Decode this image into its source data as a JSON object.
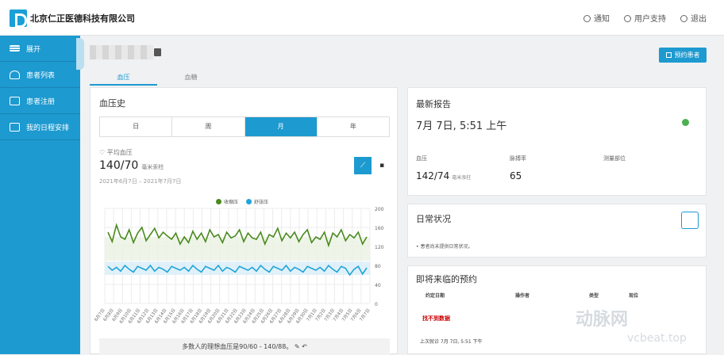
{
  "header": {
    "company": "北京仁正医德科技有限公司",
    "nav": [
      "通知",
      "用户支持",
      "退出"
    ]
  },
  "sidebar": {
    "items": [
      {
        "label": "展开",
        "icon": "menu-icon"
      },
      {
        "label": "患者列表",
        "icon": "user-icon"
      },
      {
        "label": "患者注册",
        "icon": "register-icon"
      },
      {
        "label": "我的日程安排",
        "icon": "calendar-icon"
      }
    ]
  },
  "patient": {
    "appointment_button": "预约患者"
  },
  "tabs": [
    "血压",
    "血糖"
  ],
  "bp": {
    "title": "血压史",
    "periods": [
      "日",
      "周",
      "月",
      "年"
    ],
    "active_period": 2,
    "avg_label": "平均血压",
    "avg_value": "140/70",
    "avg_unit": "毫米汞柱",
    "date_range": "2021年6月7日 – 2021年7月7日",
    "footer_note": "多数人的理想血压是90/60 - 140/88。"
  },
  "chart_data": {
    "type": "line",
    "legend": [
      "收缩压",
      "舒张压"
    ],
    "colors": {
      "systolic": "#4a8a1e",
      "diastolic": "#1ea4d8"
    },
    "ylim": [
      0,
      200
    ],
    "yticks": [
      0,
      40,
      80,
      120,
      160,
      200
    ],
    "categories": [
      "6月7日",
      "6月8日",
      "6月9日",
      "6月10日",
      "6月11日",
      "6月12日",
      "6月13日",
      "6月14日",
      "6月15日",
      "6月16日",
      "6月17日",
      "6月18日",
      "6月19日",
      "6月20日",
      "6月21日",
      "6月22日",
      "6月23日",
      "6月24日",
      "6月25日",
      "6月26日",
      "6月27日",
      "6月28日",
      "6月29日",
      "6月30日",
      "7月1日",
      "7月2日",
      "7月3日",
      "7月4日",
      "7月5日",
      "7月6日",
      "7月7日"
    ],
    "series": [
      {
        "name": "收缩压",
        "values": [
          150,
          130,
          165,
          140,
          135,
          155,
          128,
          148,
          160,
          132,
          145,
          158,
          138,
          150,
          142,
          135,
          148,
          125,
          140,
          128,
          152,
          135,
          148,
          130,
          155,
          140,
          145,
          128,
          150,
          138,
          142,
          155,
          130,
          148,
          138,
          135,
          150,
          125,
          145,
          140,
          158,
          132,
          148,
          138,
          150,
          130,
          145,
          155,
          128,
          140,
          135,
          150,
          122,
          148,
          140,
          155,
          132,
          145,
          138,
          150,
          125,
          140
        ]
      },
      {
        "name": "舒张压",
        "values": [
          78,
          70,
          76,
          68,
          80,
          72,
          66,
          78,
          74,
          70,
          80,
          68,
          76,
          72,
          66,
          78,
          74,
          70,
          76,
          68,
          80,
          72,
          66,
          78,
          74,
          70,
          80,
          68,
          76,
          72,
          66,
          78,
          74,
          70,
          76,
          68,
          80,
          72,
          66,
          78,
          74,
          70,
          80,
          68,
          76,
          72,
          66,
          78,
          74,
          70,
          76,
          68,
          80,
          72,
          66,
          78,
          74,
          60,
          72,
          78,
          62,
          75
        ]
      }
    ],
    "normal_bands": [
      [
        90,
        140
      ],
      [
        60,
        88
      ]
    ]
  },
  "report": {
    "title": "最新报告",
    "date": "7月 7日, 5:51 上午",
    "metrics": [
      {
        "label": "血压",
        "value": "142/74",
        "unit": "毫米汞柱"
      },
      {
        "label": "脉搏率",
        "value": "65",
        "unit": ""
      },
      {
        "label": "测量部位",
        "value": "",
        "unit": ""
      }
    ]
  },
  "daily": {
    "title": "日常状况",
    "item": "患者尚未提供日常状况。"
  },
  "upcoming": {
    "title": "即将来临的预约",
    "headers": [
      "约定日期",
      "操作者",
      "类型",
      "现位"
    ],
    "empty": "找不到数据",
    "last_visit": "上次就诊 7月 7日, 5:51 下午"
  },
  "watermark": {
    "brand": "动脉网",
    "url": "vcbeat.top"
  }
}
